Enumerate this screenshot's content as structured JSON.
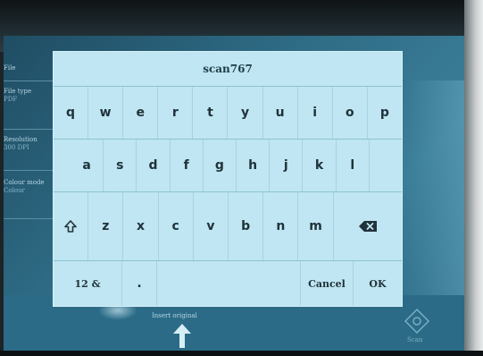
{
  "keyboard": {
    "title": "scan767",
    "row1": [
      "q",
      "w",
      "e",
      "r",
      "t",
      "y",
      "u",
      "i",
      "o",
      "p"
    ],
    "row2": [
      "a",
      "s",
      "d",
      "f",
      "g",
      "h",
      "j",
      "k",
      "l"
    ],
    "row3": [
      "z",
      "x",
      "c",
      "v",
      "b",
      "n",
      "m"
    ],
    "mode_label": "12 &",
    "dot_label": ".",
    "cancel_label": "Cancel",
    "ok_label": "OK",
    "shift_icon": "shift-arrow-icon",
    "backspace_icon": "backspace-icon"
  },
  "background_panel": {
    "items": [
      {
        "label": "File",
        "value": ""
      },
      {
        "label": "File type",
        "value": "PDF"
      },
      {
        "label": "Resolution",
        "value": "300 DPI"
      },
      {
        "label": "Colour mode",
        "value": "Colour"
      }
    ],
    "insert_label": "Insert original",
    "start_label": "Scan"
  },
  "colors": {
    "keyboard_bg": "#bfe6f2",
    "key_text": "#20323a",
    "screen_bg": "#2f6c86"
  }
}
